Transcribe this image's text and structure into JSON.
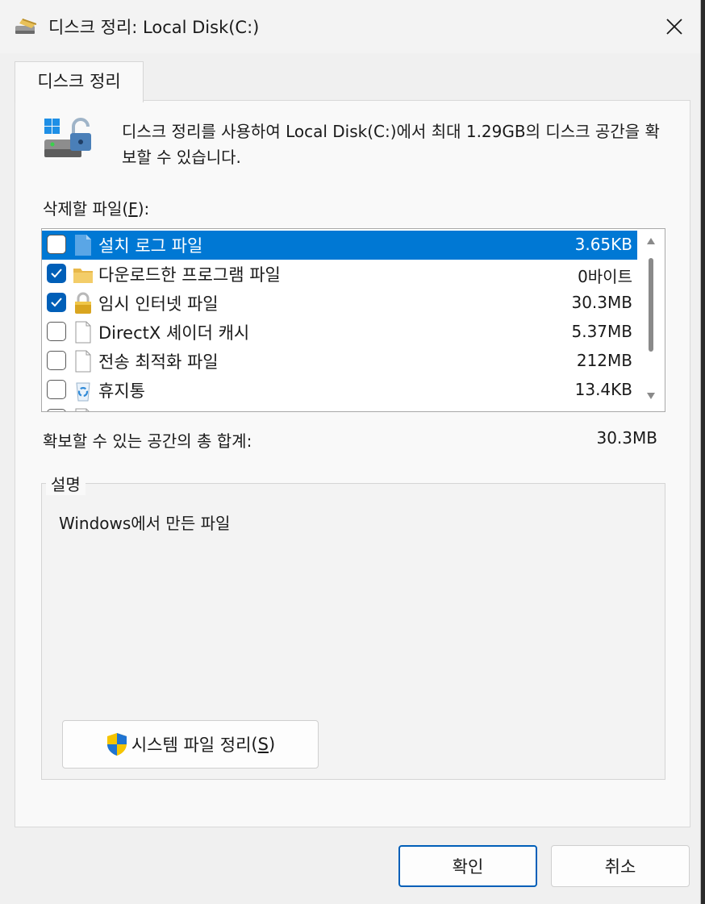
{
  "window": {
    "title": "디스크 정리: Local Disk(C:)"
  },
  "tab": {
    "label": "디스크 정리"
  },
  "description": "디스크 정리를 사용하여 Local Disk(C:)에서 최대 1.29GB의 디스크 공간을 확보할 수 있습니다.",
  "files_label": {
    "text": "삭제할 파일",
    "mnemonic": "F",
    "suffix": ":"
  },
  "files": [
    {
      "name": "설치 로그 파일",
      "size": "3.65KB",
      "checked": false,
      "selected": true,
      "icon": "document-icon"
    },
    {
      "name": "다운로드한 프로그램 파일",
      "size": "0바이트",
      "checked": true,
      "selected": false,
      "icon": "folder-icon"
    },
    {
      "name": "임시 인터넷 파일",
      "size": "30.3MB",
      "checked": true,
      "selected": false,
      "icon": "lock-icon"
    },
    {
      "name": "DirectX 셰이더 캐시",
      "size": "5.37MB",
      "checked": false,
      "selected": false,
      "icon": "blank-page-icon"
    },
    {
      "name": "전송 최적화 파일",
      "size": "212MB",
      "checked": false,
      "selected": false,
      "icon": "blank-page-icon"
    },
    {
      "name": "휴지통",
      "size": "13.4KB",
      "checked": false,
      "selected": false,
      "icon": "recycle-bin-icon"
    },
    {
      "name": "",
      "size": "",
      "checked": false,
      "selected": false,
      "icon": "blank-page-icon"
    }
  ],
  "total": {
    "label": "확보할 수 있는 공간의 총 합계:",
    "value": "30.3MB"
  },
  "group": {
    "label": "설명",
    "text": "Windows에서 만든 파일"
  },
  "buttons": {
    "system_cleanup": {
      "text": "시스템 파일 정리",
      "mnemonic": "S"
    },
    "ok": "확인",
    "cancel": "취소"
  },
  "colors": {
    "accent": "#005fb8",
    "selection": "#0078d4"
  }
}
